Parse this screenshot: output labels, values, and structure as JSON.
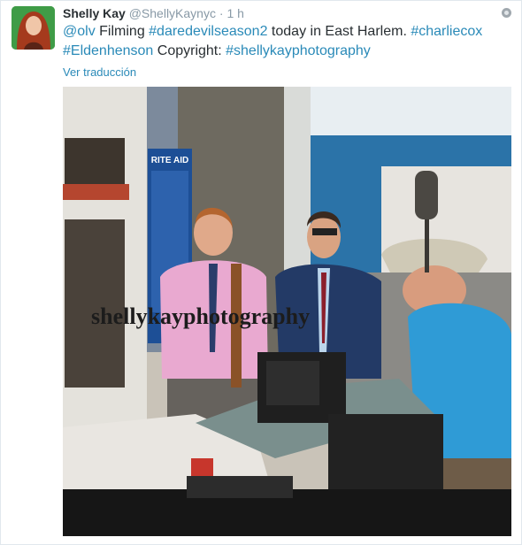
{
  "user": {
    "name": "Shelly Kay",
    "handle": "@ShellyKaynyc",
    "separator": "·",
    "time": "1 h"
  },
  "tweet": {
    "mention": "@olv",
    "part1": " Filming ",
    "hashtag1": "#daredevilseason2",
    "part2": " today in East Harlem. ",
    "hashtag2": "#charliecox",
    "hashtag3": "#Eldenhenson",
    "part3": " Copyright: ",
    "hashtag4": "#shellykayphotography"
  },
  "translate_label": "Ver traducción",
  "photo": {
    "watermark": "shellykayphotography",
    "sign_text": "RITE AID"
  },
  "colors": {
    "link": "#2a8ab8",
    "name": "#292f33",
    "meta": "#8899a6"
  },
  "icons": [
    "globe-icon"
  ]
}
